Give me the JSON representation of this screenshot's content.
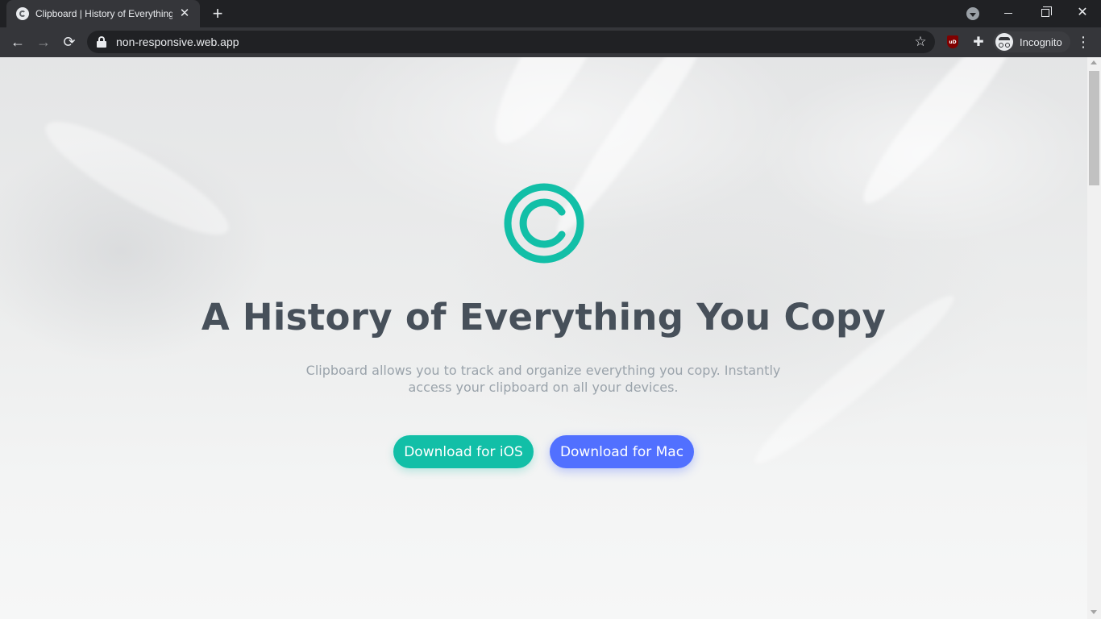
{
  "browser": {
    "tab": {
      "title": "Clipboard | History of Everything",
      "close_glyph": "✕"
    },
    "new_tab_glyph": "+",
    "window_controls": {
      "close_glyph": "✕"
    },
    "nav": {
      "back_glyph": "←",
      "forward_glyph": "→",
      "reload_glyph": "⟳"
    },
    "omnibox": {
      "url": "non-responsive.web.app",
      "star_glyph": "☆"
    },
    "extensions": {
      "ublock_label": "uD",
      "puzzle_glyph": "✚"
    },
    "profile": {
      "label": "Incognito"
    },
    "menu_glyph": "⋮"
  },
  "page": {
    "headline": "A History of Everything You Copy",
    "subtitle": "Clipboard allows you to track and organize everything you copy. Instantly access your clipboard on all your devices.",
    "buttons": {
      "ios": "Download for iOS",
      "mac": "Download for Mac"
    },
    "colors": {
      "brand": "#12bfa7",
      "mac_button": "#5170ff",
      "headline": "#47505a",
      "subtitle": "#9aa3ab"
    },
    "logo_icon": "copyright-c-icon"
  }
}
